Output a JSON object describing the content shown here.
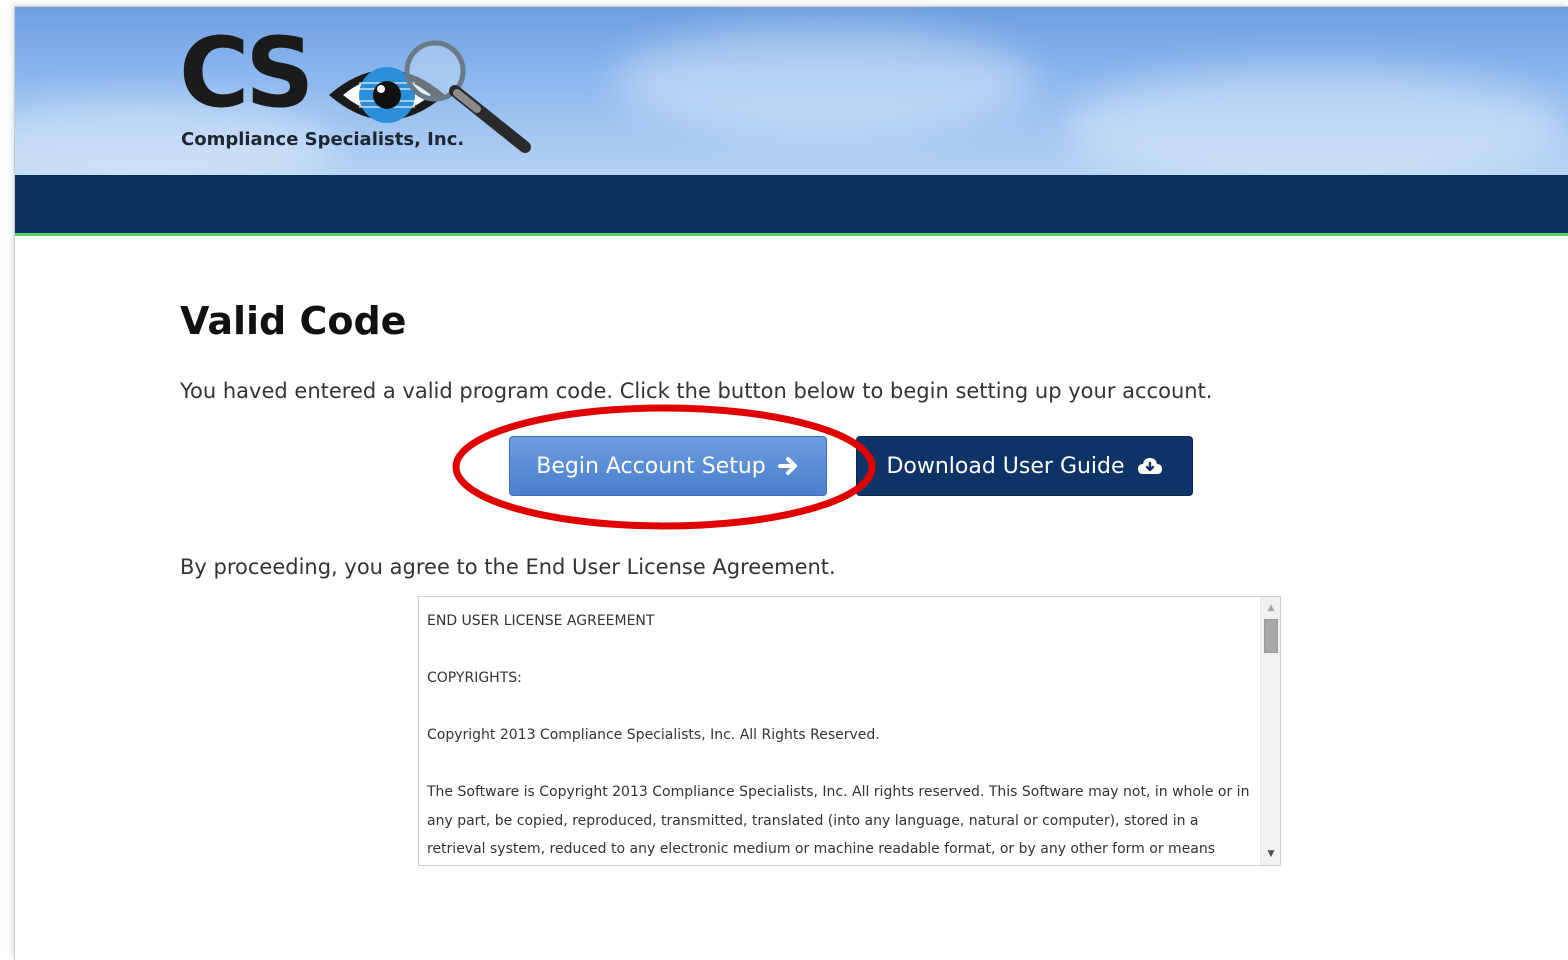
{
  "header": {
    "logo_letters": "CS",
    "logo_tagline": "Compliance Specialists, Inc."
  },
  "main": {
    "title": "Valid Code",
    "intro": "You haved entered a valid program code. Click the button below to begin setting up your account.",
    "begin_button": "Begin Account Setup",
    "guide_button": "Download User Guide",
    "agreement_notice": "By proceeding, you agree to the End User License Agreement."
  },
  "eula": {
    "heading": "END USER LICENSE AGREEMENT",
    "copyrights_label": "COPYRIGHTS:",
    "copyright_line": "Copyright 2013 Compliance Specialists, Inc. All Rights Reserved.",
    "body": "The Software is Copyright 2013 Compliance Specialists, Inc. All rights reserved. This Software may not, in whole or in any part, be copied, reproduced, transmitted, translated (into any language, natural or computer), stored in a retrieval system, reduced to any electronic medium or machine readable format, or by any other form or means"
  },
  "colors": {
    "navbar": "#0b2f5e",
    "accent_line": "#5fcf6c",
    "begin_button": "#5a8ed6",
    "guide_button": "#0e3467",
    "highlight_ring": "#e00000"
  },
  "icons": {
    "begin_button_icon": "arrow-right-icon",
    "guide_button_icon": "cloud-download-icon",
    "logo_icon": "eye-magnifier-icon"
  }
}
